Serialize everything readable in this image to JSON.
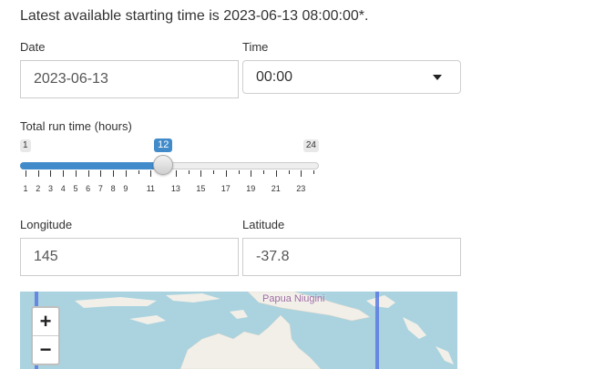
{
  "headline": "Latest available starting time is 2023-06-13 08:00:00*.",
  "date": {
    "label": "Date",
    "value": "2023-06-13"
  },
  "time": {
    "label": "Time",
    "value": "00:00"
  },
  "runtime": {
    "label": "Total run time (hours)",
    "min": 1,
    "max": 24,
    "value": 12,
    "min_label": "1",
    "max_label": "24",
    "value_label": "12",
    "tick_labels": [
      "1",
      "2",
      "3",
      "4",
      "5",
      "6",
      "7",
      "8",
      "9",
      "11",
      "13",
      "15",
      "17",
      "19",
      "21",
      "23"
    ]
  },
  "longitude": {
    "label": "Longitude",
    "value": "145"
  },
  "latitude": {
    "label": "Latitude",
    "value": "-37.8"
  },
  "map": {
    "zoom_in": "+",
    "zoom_out": "−",
    "place_label": "Papua Niugini"
  },
  "colors": {
    "accent": "#428bca",
    "map_water": "#aad3df",
    "map_land": "#f2efe9",
    "meridian": "#5b7ae0"
  }
}
